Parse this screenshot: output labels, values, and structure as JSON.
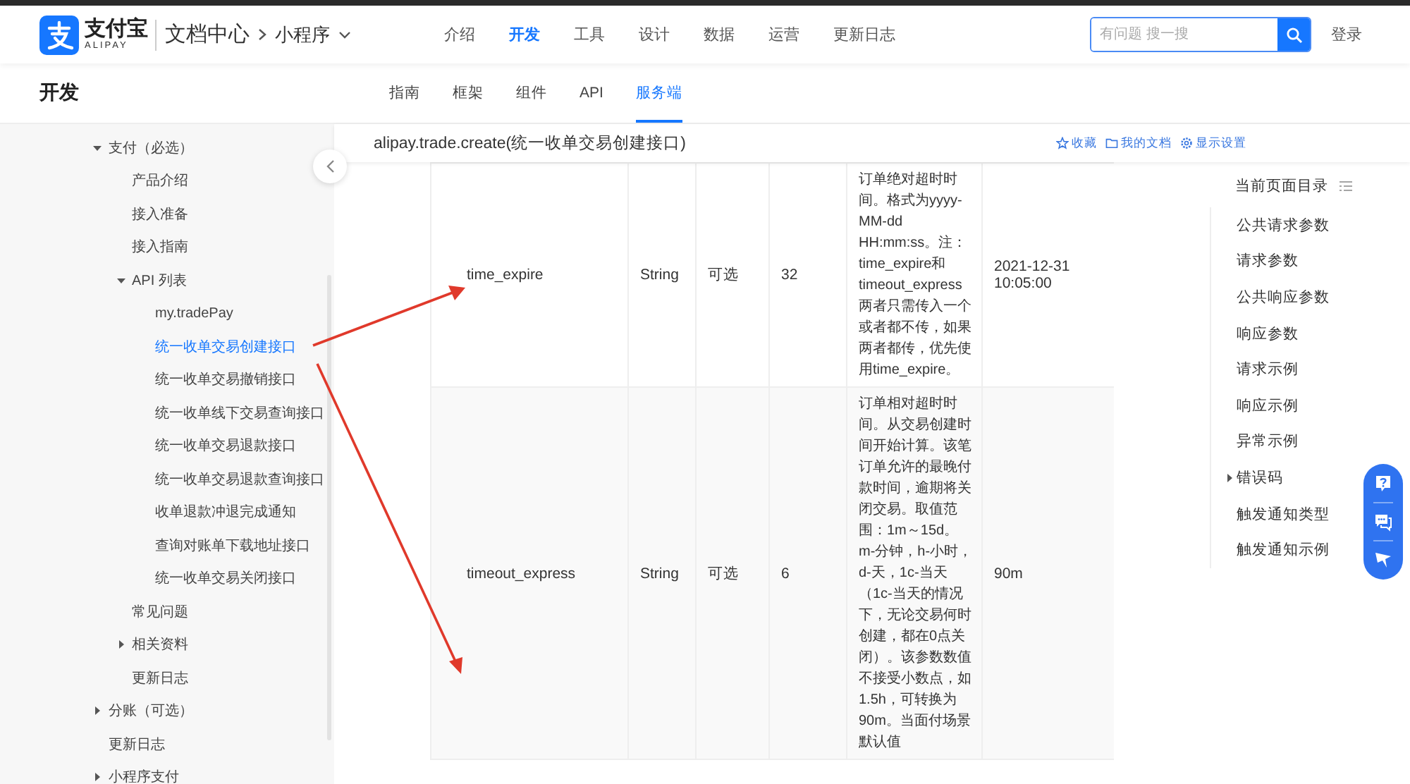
{
  "header": {
    "logo": {
      "name": "支付宝",
      "latin": "ALIPAY"
    },
    "section": "文档中心",
    "product": "小程序",
    "nav": [
      {
        "label": "介绍",
        "selected": false
      },
      {
        "label": "开发",
        "selected": true
      },
      {
        "label": "工具",
        "selected": false
      },
      {
        "label": "设计",
        "selected": false
      },
      {
        "label": "数据",
        "selected": false
      },
      {
        "label": "运营",
        "selected": false
      },
      {
        "label": "更新日志",
        "selected": false
      }
    ],
    "search": {
      "placeholder": "有问题 搜一搜"
    },
    "login": "登录"
  },
  "subheader": {
    "title": "开发",
    "tabs": [
      {
        "label": "指南",
        "selected": false
      },
      {
        "label": "框架",
        "selected": false
      },
      {
        "label": "组件",
        "selected": false
      },
      {
        "label": "API",
        "selected": false
      },
      {
        "label": "服务端",
        "selected": true
      }
    ]
  },
  "sidebar": {
    "items": [
      {
        "label": "支付（必选）",
        "kind": "branch",
        "expanded": true,
        "selected": false,
        "children": [
          {
            "label": "产品介绍",
            "kind": "leaf",
            "selected": false
          },
          {
            "label": "接入准备",
            "kind": "leaf",
            "selected": false
          },
          {
            "label": "接入指南",
            "kind": "leaf",
            "selected": false
          },
          {
            "label": "API 列表",
            "kind": "branch",
            "expanded": true,
            "selected": false,
            "children": [
              {
                "label": "my.tradePay",
                "kind": "leaf",
                "selected": false
              },
              {
                "label": "统一收单交易创建接口",
                "kind": "leaf",
                "selected": true
              },
              {
                "label": "统一收单交易撤销接口",
                "kind": "leaf",
                "selected": false
              },
              {
                "label": "统一收单线下交易查询接口",
                "kind": "leaf",
                "selected": false
              },
              {
                "label": "统一收单交易退款接口",
                "kind": "leaf",
                "selected": false
              },
              {
                "label": "统一收单交易退款查询接口",
                "kind": "leaf",
                "selected": false
              },
              {
                "label": "收单退款冲退完成通知",
                "kind": "leaf",
                "selected": false
              },
              {
                "label": "查询对账单下载地址接口",
                "kind": "leaf",
                "selected": false
              },
              {
                "label": "统一收单交易关闭接口",
                "kind": "leaf",
                "selected": false
              }
            ]
          },
          {
            "label": "常见问题",
            "kind": "leaf",
            "selected": false
          },
          {
            "label": "相关资料",
            "kind": "branch",
            "expanded": false,
            "selected": false
          },
          {
            "label": "更新日志",
            "kind": "leaf",
            "selected": false
          }
        ]
      },
      {
        "label": "分账（可选）",
        "kind": "branch",
        "expanded": false,
        "selected": false
      },
      {
        "label": "更新日志",
        "kind": "leaf",
        "selected": false
      },
      {
        "label": "小程序支付",
        "kind": "branch",
        "expanded": false,
        "selected": false
      }
    ]
  },
  "doc": {
    "title": "alipay.trade.create(统一收单交易创建接口)",
    "actions": [
      {
        "kind": "star",
        "label": "收藏"
      },
      {
        "kind": "folder",
        "label": "我的文档"
      },
      {
        "kind": "gear",
        "label": "显示设置"
      }
    ]
  },
  "table": {
    "rows": [
      {
        "name": "time_expire",
        "type": "String",
        "required": "可选",
        "length": "32",
        "description": "订单绝对超时时间。格式为yyyy-MM-dd HH:mm:ss。注：time_expire和timeout_express两者只需传入一个或者都不传，如果两者都传，优先使用time_expire。",
        "example": "2021-12-31 10:05:00"
      },
      {
        "name": "timeout_express",
        "type": "String",
        "required": "可选",
        "length": "6",
        "description": "订单相对超时时间。从交易创建时间开始计算。该笔订单允许的最晚付款时间，逾期将关闭交易。取值范围：1m～15d。m-分钟，h-小时，d-天，1c-当天（1c-当天的情况下，无论交易何时创建，都在0点关闭）。该参数数值不接受小数点，如 1.5h，可转换为 90m。当面付场景默认值",
        "example": "90m"
      }
    ]
  },
  "toc": {
    "title": "当前页面目录",
    "items": [
      {
        "label": "公共请求参数",
        "kind": "leaf"
      },
      {
        "label": "请求参数",
        "kind": "leaf"
      },
      {
        "label": "公共响应参数",
        "kind": "leaf"
      },
      {
        "label": "响应参数",
        "kind": "leaf"
      },
      {
        "label": "请求示例",
        "kind": "leaf"
      },
      {
        "label": "响应示例",
        "kind": "leaf"
      },
      {
        "label": "异常示例",
        "kind": "leaf"
      },
      {
        "label": "错误码",
        "kind": "branch",
        "expanded": false
      },
      {
        "label": "触发通知类型",
        "kind": "leaf"
      },
      {
        "label": "触发通知示例",
        "kind": "leaf"
      }
    ]
  }
}
